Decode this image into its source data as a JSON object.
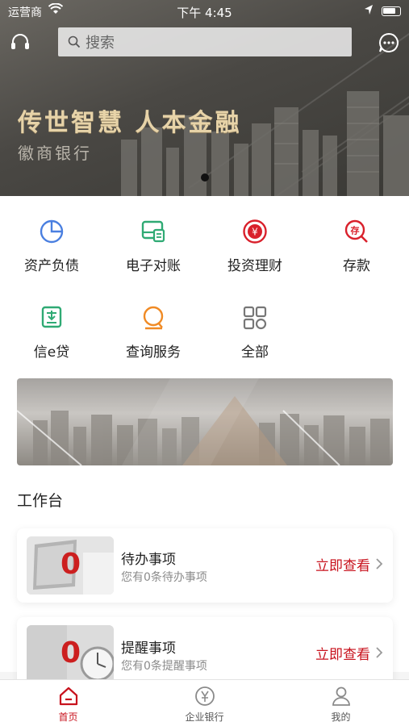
{
  "status_bar": {
    "carrier": "运营商",
    "time": "下午 4:45"
  },
  "header": {
    "search_placeholder": "搜索",
    "slogan": "传世智慧 人本金融",
    "bank_name": "徽商银行"
  },
  "quick_actions": [
    {
      "label": "资产负债",
      "icon": "pie-chart-icon"
    },
    {
      "label": "电子对账",
      "icon": "statement-icon"
    },
    {
      "label": "投资理财",
      "icon": "yuan-coin-icon"
    },
    {
      "label": "存款",
      "icon": "deposit-icon"
    },
    {
      "label": "信e贷",
      "icon": "loan-icon"
    },
    {
      "label": "查询服务",
      "icon": "query-icon"
    },
    {
      "label": "全部",
      "icon": "grid-all-icon"
    }
  ],
  "workbench": {
    "title": "工作台",
    "cards": [
      {
        "count": "0",
        "title": "待办事项",
        "subtitle": "您有0条待办事项",
        "action": "立即查看"
      },
      {
        "count": "0",
        "title": "提醒事项",
        "subtitle": "您有0条提醒事项",
        "action": "立即查看"
      }
    ]
  },
  "tabbar": {
    "items": [
      {
        "label": "首页",
        "active": true
      },
      {
        "label": "企业银行",
        "active": false
      },
      {
        "label": "我的",
        "active": false
      }
    ]
  },
  "colors": {
    "brand_red": "#c8121d",
    "slogan_gold": "#e7d3a8"
  }
}
